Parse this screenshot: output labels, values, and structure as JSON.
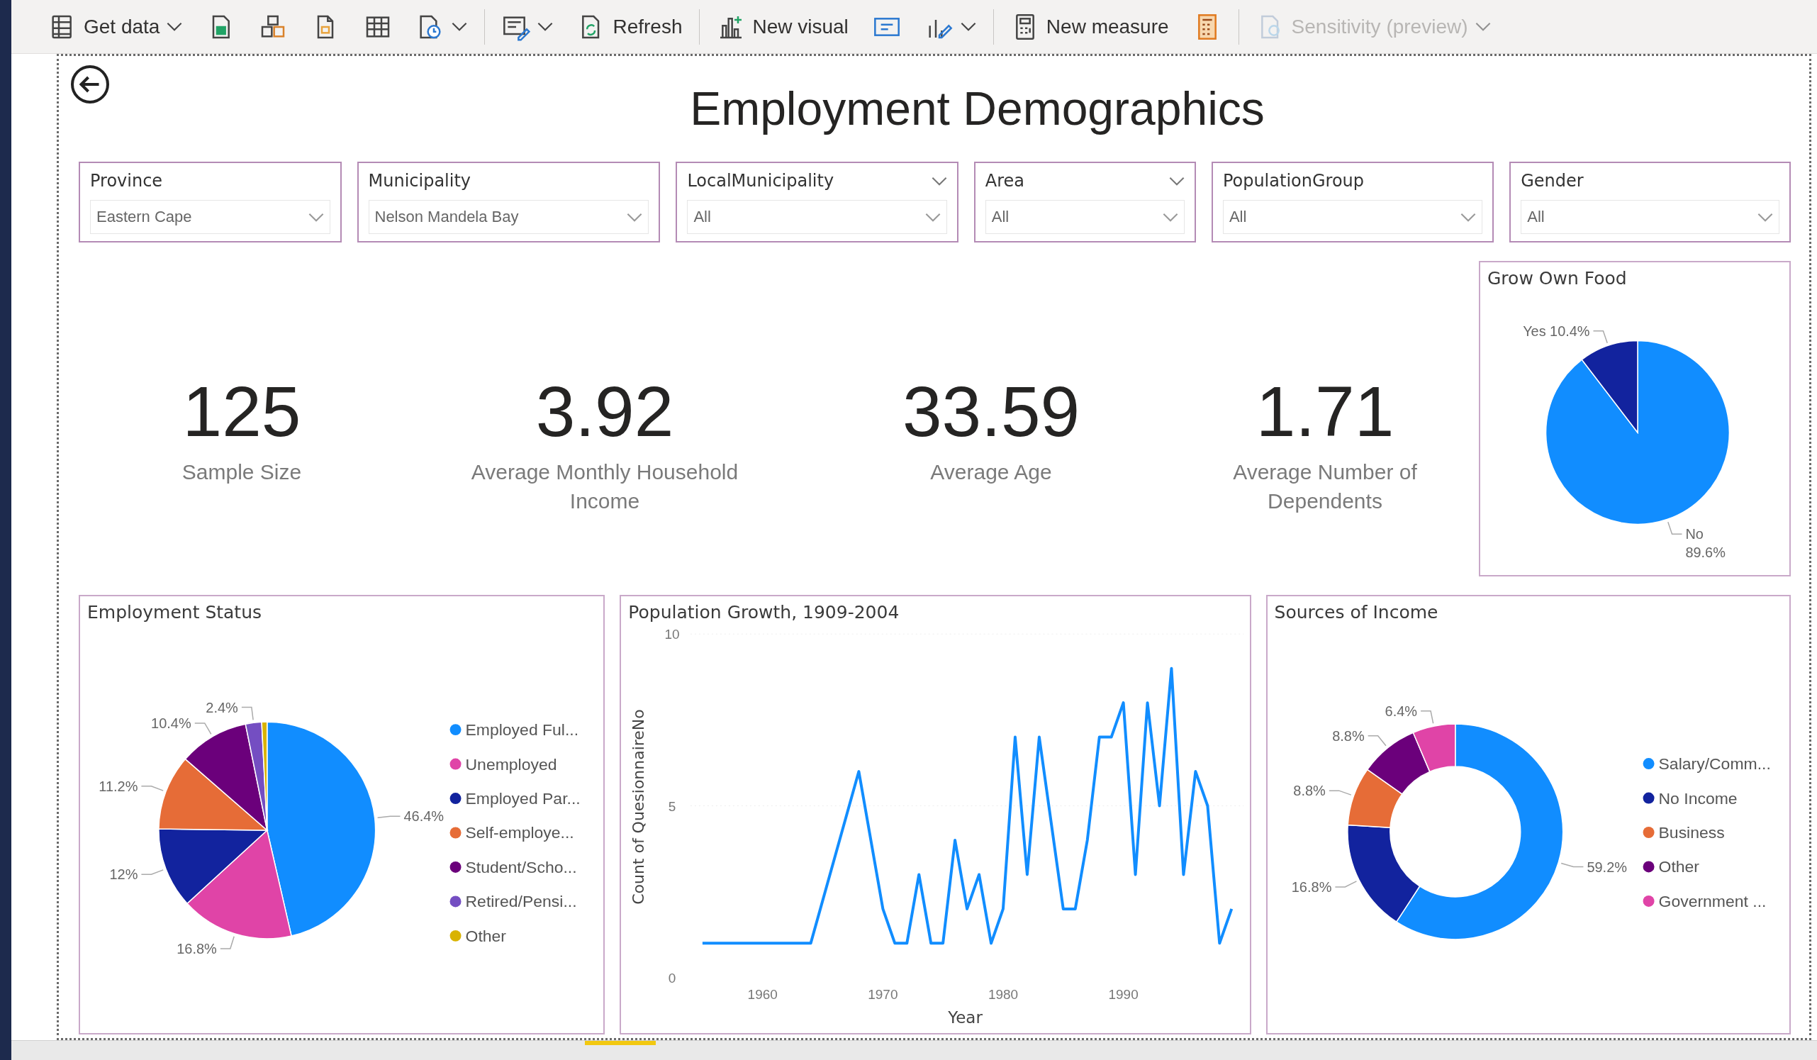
{
  "toolbar": {
    "groups": [
      {
        "items": [
          {
            "label": "Get data",
            "dropdown": true,
            "disabled": false
          },
          {
            "dropdown": false,
            "disabled": false
          },
          {
            "dropdown": false,
            "disabled": false
          },
          {
            "dropdown": false,
            "disabled": false
          },
          {
            "dropdown": false,
            "disabled": false
          },
          {
            "dropdown": true,
            "disabled": false
          }
        ]
      },
      {
        "items": [
          {
            "dropdown": true,
            "disabled": false
          },
          {
            "label": "Refresh",
            "dropdown": false,
            "disabled": false
          }
        ]
      },
      {
        "items": [
          {
            "label": "New visual",
            "dropdown": false,
            "disabled": false
          },
          {
            "dropdown": false,
            "disabled": false
          },
          {
            "dropdown": true,
            "disabled": false
          }
        ]
      },
      {
        "items": [
          {
            "label": "New measure",
            "dropdown": false,
            "disabled": false
          },
          {
            "dropdown": false,
            "disabled": false
          }
        ]
      },
      {
        "items": [
          {
            "label": "Sensitivity (preview)",
            "dropdown": true,
            "disabled": true
          }
        ]
      }
    ]
  },
  "report": {
    "title": "Employment Demographics",
    "slicers": [
      {
        "label": "Province",
        "value": "Eastern Cape",
        "header_caret": false
      },
      {
        "label": "Municipality",
        "value": "Nelson Mandela Bay",
        "header_caret": false
      },
      {
        "label": "LocalMunicipality",
        "value": "All",
        "header_caret": true
      },
      {
        "label": "Area",
        "value": "All",
        "header_caret": true
      },
      {
        "label": "PopulationGroup",
        "value": "All",
        "header_caret": false
      },
      {
        "label": "Gender",
        "value": "All",
        "header_caret": false
      }
    ],
    "cards": [
      {
        "value": "125",
        "label": "Sample Size"
      },
      {
        "value": "3.92",
        "label": "Average Monthly Household Income"
      },
      {
        "value": "33.59",
        "label": "Average Age"
      },
      {
        "value": "1.71",
        "label": "Average Number of Dependents"
      }
    ],
    "grow_own_food": {
      "chart_data": {
        "type": "pie",
        "title": "Grow Own Food",
        "legend": false,
        "categories": [
          "No",
          "Yes"
        ],
        "series": [
          {
            "values": [
              89.6,
              10.4
            ],
            "colors": [
              "#118dff",
              "#12239e"
            ]
          }
        ],
        "value_labels": [
          "89.6%",
          "10.4%"
        ]
      }
    },
    "visuals": [
      {
        "chart_data": {
          "type": "pie",
          "title": "Employment Status",
          "legend": true,
          "categories": [
            "Employed Ful...",
            "Unemployed",
            "Employed Par...",
            "Self-employe...",
            "Student/Scho...",
            "Retired/Pensi...",
            "Other"
          ],
          "series": [
            {
              "values": [
                46.4,
                16.8,
                12,
                11.2,
                10.4,
                2.4,
                0.8
              ],
              "colors": [
                "#118dff",
                "#e044a7",
                "#12239e",
                "#e66c37",
                "#6b007b",
                "#744ec2",
                "#d9b300"
              ]
            }
          ],
          "value_labels": [
            "46.4%",
            "16.8%",
            "12%",
            "11.2%",
            "10.4%",
            "2.4%",
            null
          ]
        }
      },
      {
        "chart_data": {
          "type": "line",
          "title": "Population Growth, 1909-2004",
          "xlabel": "Year",
          "ylabel": "Count of QuesionnaireNo",
          "x": [
            1955,
            1964,
            1968,
            1970,
            1971,
            1972,
            1973,
            1974,
            1975,
            1976,
            1977,
            1978,
            1979,
            1980,
            1981,
            1982,
            1983,
            1985,
            1986,
            1987,
            1988,
            1989,
            1990,
            1991,
            1992,
            1993,
            1994,
            1995,
            1996,
            1997,
            1998,
            1999
          ],
          "series": [
            {
              "color": "#118dff",
              "values": [
                1,
                1,
                6,
                2,
                1,
                1,
                3,
                1,
                1,
                4,
                2,
                3,
                1,
                2,
                7,
                3,
                7,
                2,
                2,
                4,
                7,
                7,
                8,
                3,
                8,
                5,
                9,
                3,
                6,
                5,
                1,
                2
              ]
            }
          ],
          "xlim": [
            1954,
            2000
          ],
          "ylim": [
            0,
            10
          ],
          "xticks": [
            1960,
            1970,
            1980,
            1990
          ],
          "yticks": [
            0,
            5,
            10
          ]
        }
      },
      {
        "chart_data": {
          "type": "donut",
          "title": "Sources of Income",
          "legend": true,
          "categories": [
            "Salary/Comm...",
            "No Income",
            "Business",
            "Other",
            "Government ..."
          ],
          "series": [
            {
              "values": [
                59.2,
                16.8,
                8.8,
                8.8,
                6.4
              ],
              "colors": [
                "#118dff",
                "#12239e",
                "#e66c37",
                "#6b007b",
                "#e044a7"
              ]
            }
          ],
          "value_labels": [
            "59.2%",
            "16.8%",
            "8.8%",
            "8.8%",
            "6.4%"
          ]
        }
      }
    ]
  }
}
